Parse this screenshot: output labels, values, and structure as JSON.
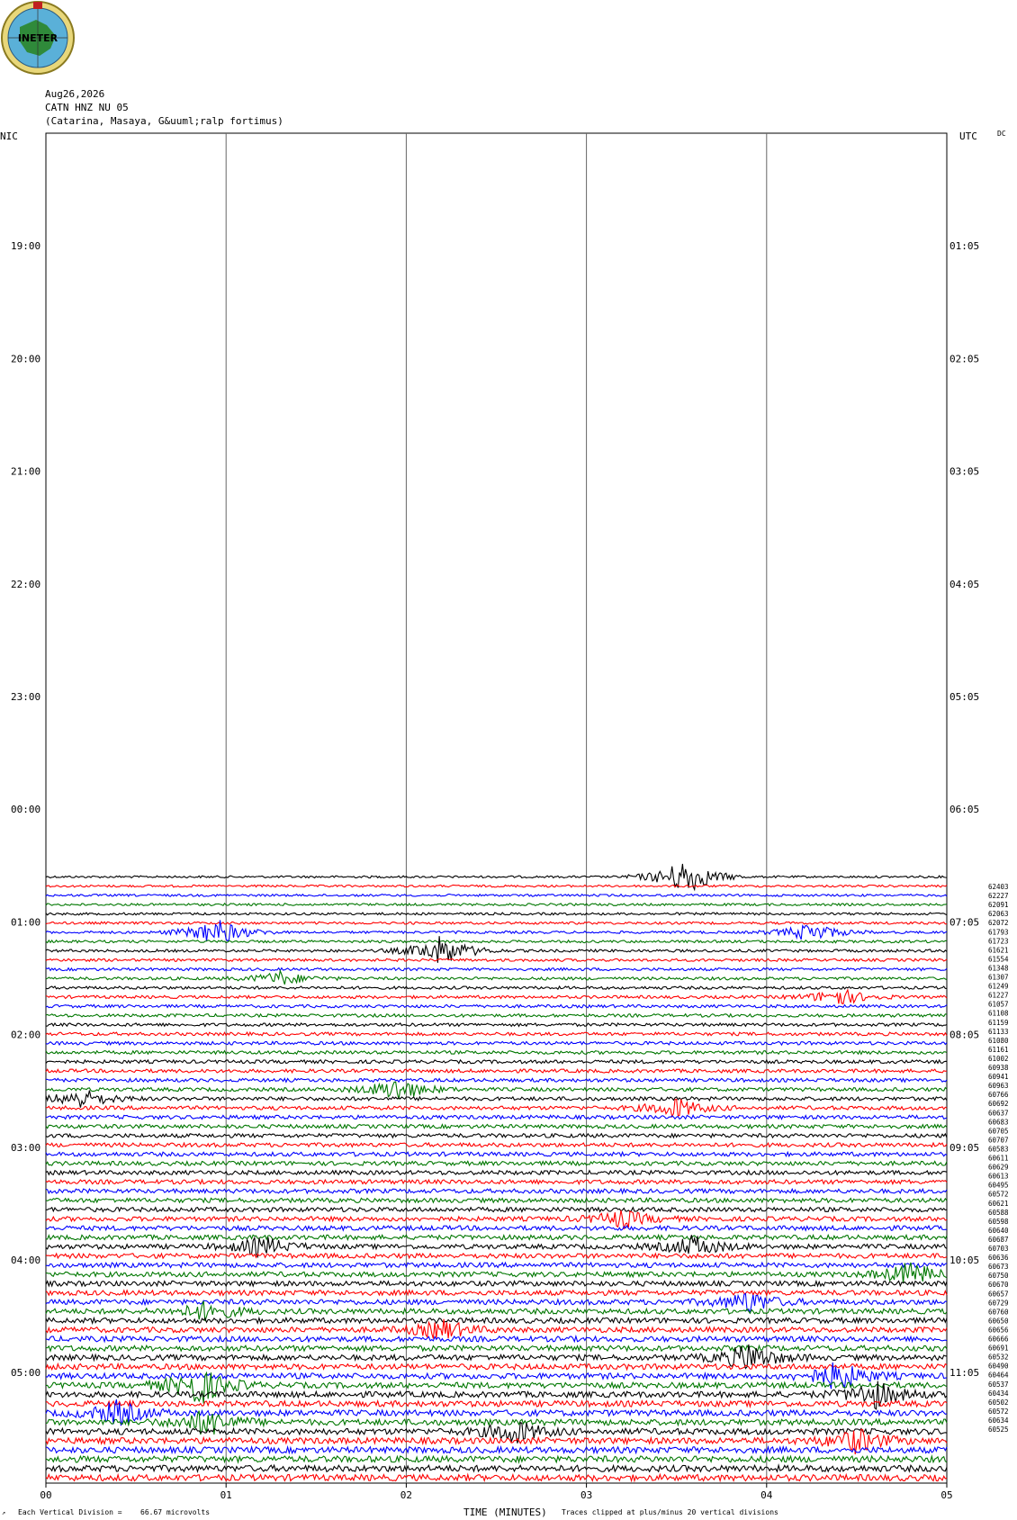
{
  "logo": {
    "text": "INETER"
  },
  "header": {
    "date": "Aug26,2026",
    "channel": "CATN HNZ NU 05",
    "location": "(Catarina, Masaya, G&uuml;ralp fortimus)"
  },
  "left_axis_label": "NIC",
  "right_axis_label": "UTC",
  "corner_mark": "DC",
  "x_axis_title": "TIME (MINUTES)",
  "footer": {
    "division_note": "Each Vertical Division =",
    "division_value": "66.67 microvolts",
    "clip_note": "Traces clipped at plus/minus 20 vertical divisions"
  },
  "colors": {
    "trace_cycle": [
      "#000000",
      "#ff0000",
      "#0000ff",
      "#007700"
    ],
    "grid": "#666666"
  },
  "chart_data": {
    "type": "line",
    "title": "CATN HNZ NU 05",
    "xlabel": "TIME (MINUTES)",
    "xlim": [
      0,
      5
    ],
    "x_ticks": [
      "00",
      "01",
      "02",
      "03",
      "04",
      "05"
    ],
    "hour_rows": [
      {
        "nic": "",
        "utc": ""
      },
      {
        "nic": "19:00",
        "utc": "01:05"
      },
      {
        "nic": "20:00",
        "utc": "02:05"
      },
      {
        "nic": "21:00",
        "utc": "03:05"
      },
      {
        "nic": "22:00",
        "utc": "04:05"
      },
      {
        "nic": "23:00",
        "utc": "05:05"
      },
      {
        "nic": "00:00",
        "utc": "06:05"
      },
      {
        "nic": "01:00",
        "utc": "07:05"
      },
      {
        "nic": "02:00",
        "utc": "08:05"
      },
      {
        "nic": "03:00",
        "utc": "09:05"
      },
      {
        "nic": "04:00",
        "utc": "10:05"
      },
      {
        "nic": "05:00",
        "utc": "11:05"
      }
    ],
    "trace_start_hour_offset": 6.6,
    "trace_count": 66,
    "trace_values": [
      "62403",
      "62227",
      "62091",
      "62063",
      "62072",
      "61793",
      "61723",
      "61621",
      "61554",
      "61348",
      "61307",
      "61249",
      "61227",
      "61057",
      "61108",
      "61159",
      "61133",
      "61080",
      "61161",
      "61002",
      "60938",
      "60941",
      "60963",
      "60766",
      "60692",
      "60637",
      "60683",
      "60705",
      "60707",
      "60583",
      "60611",
      "60629",
      "60613",
      "60495",
      "60572",
      "60621",
      "60588",
      "60598",
      "60640",
      "60687",
      "60703",
      "60636",
      "60673",
      "60750",
      "60670",
      "60657",
      "60729",
      "60760",
      "60650",
      "60656",
      "60666",
      "60691",
      "60532",
      "60490",
      "60464",
      "60537",
      "60434",
      "60502",
      "60572",
      "60634",
      "60525"
    ],
    "events": [
      {
        "trace": 0,
        "t": 3.55,
        "amp": 1.0
      },
      {
        "trace": 6,
        "t": 0.95,
        "amp": 0.7
      },
      {
        "trace": 6,
        "t": 4.25,
        "amp": 0.5
      },
      {
        "trace": 8,
        "t": 2.2,
        "amp": 0.8
      },
      {
        "trace": 11,
        "t": 1.3,
        "amp": 0.35
      },
      {
        "trace": 13,
        "t": 4.4,
        "amp": 0.45
      },
      {
        "trace": 23,
        "t": 1.95,
        "amp": 0.6
      },
      {
        "trace": 24,
        "t": 0.2,
        "amp": 0.5
      },
      {
        "trace": 25,
        "t": 3.5,
        "amp": 0.5
      },
      {
        "trace": 37,
        "t": 3.2,
        "amp": 0.45
      },
      {
        "trace": 40,
        "t": 1.2,
        "amp": 0.5
      },
      {
        "trace": 40,
        "t": 3.6,
        "amp": 0.55
      },
      {
        "trace": 43,
        "t": 4.8,
        "amp": 0.6
      },
      {
        "trace": 46,
        "t": 3.9,
        "amp": 0.55
      },
      {
        "trace": 47,
        "t": 0.9,
        "amp": 0.5
      },
      {
        "trace": 49,
        "t": 2.2,
        "amp": 0.5
      },
      {
        "trace": 52,
        "t": 3.9,
        "amp": 0.7
      },
      {
        "trace": 54,
        "t": 4.4,
        "amp": 0.75
      },
      {
        "trace": 55,
        "t": 0.85,
        "amp": 1.0
      },
      {
        "trace": 56,
        "t": 4.6,
        "amp": 0.7
      },
      {
        "trace": 58,
        "t": 0.4,
        "amp": 0.6
      },
      {
        "trace": 59,
        "t": 0.9,
        "amp": 0.7
      },
      {
        "trace": 60,
        "t": 2.6,
        "amp": 0.6
      },
      {
        "trace": 61,
        "t": 4.5,
        "amp": 0.6
      }
    ]
  }
}
